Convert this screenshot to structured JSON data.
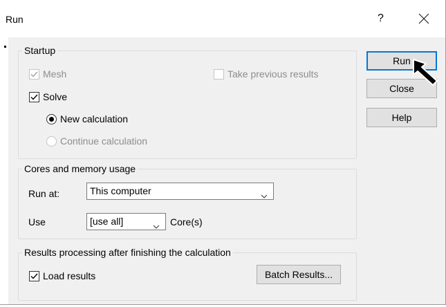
{
  "window": {
    "title": "Run",
    "help_glyph": "?",
    "close_icon": "close-icon"
  },
  "startup": {
    "legend": "Startup",
    "mesh": {
      "label": "Mesh",
      "checked": true,
      "disabled": true
    },
    "take_previous": {
      "label": "Take previous results",
      "checked": false,
      "disabled": true
    },
    "solve": {
      "label": "Solve",
      "checked": true
    },
    "new_calc": {
      "label": "New calculation",
      "selected": true
    },
    "continue_calc": {
      "label": "Continue calculation",
      "selected": false,
      "disabled": true
    }
  },
  "cores": {
    "legend": "Cores and memory usage",
    "run_at_label": "Run at:",
    "run_at_value": "This computer",
    "use_label": "Use",
    "use_value": "[use all]",
    "cores_suffix": "Core(s)"
  },
  "results": {
    "legend": "Results processing after finishing the calculation",
    "load_results": {
      "label": "Load results",
      "checked": true
    },
    "batch_button": "Batch Results..."
  },
  "buttons": {
    "run": "Run",
    "close": "Close",
    "help": "Help"
  },
  "colors": {
    "accent": "#0078d7",
    "panel": "#f0f0f0",
    "button_face": "#e1e1e1"
  }
}
